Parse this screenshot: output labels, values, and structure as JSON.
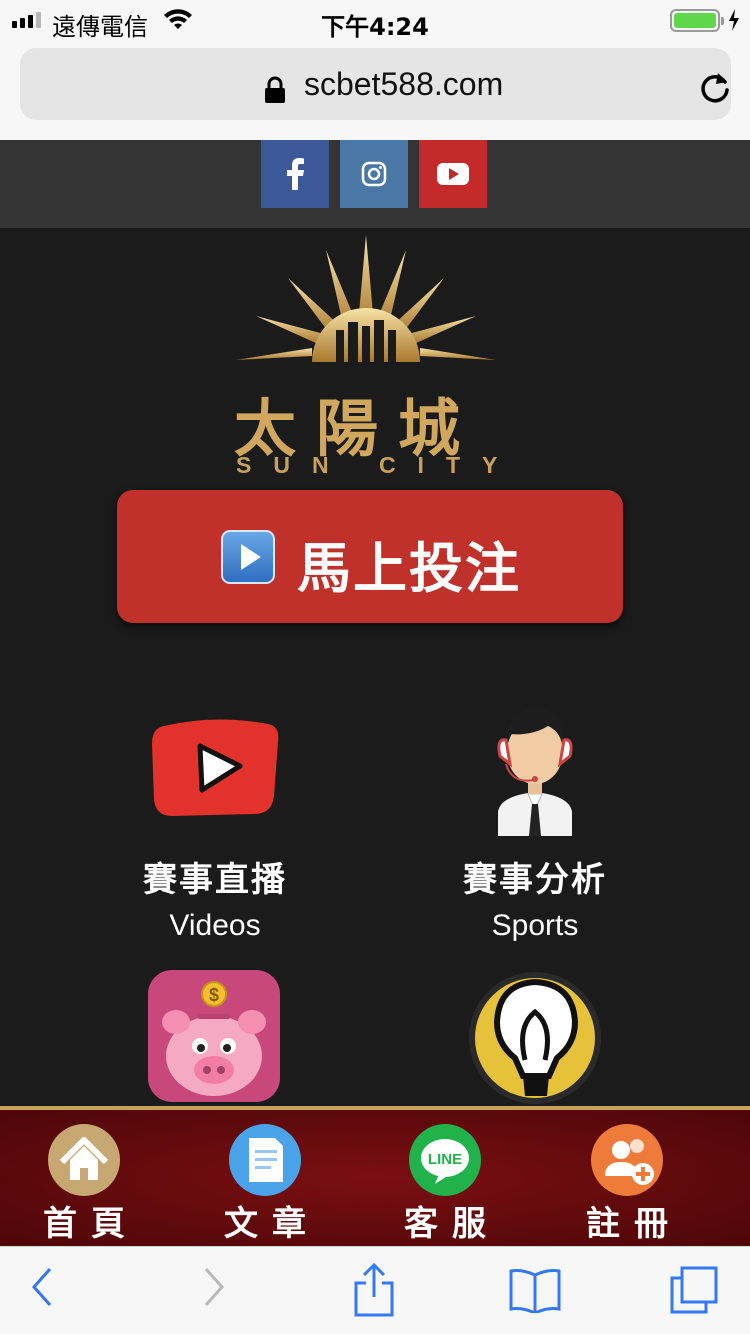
{
  "status_bar": {
    "carrier": "遠傳電信",
    "time": "下午4:24",
    "battery_level": 1.0
  },
  "browser": {
    "url": "scbet588.com"
  },
  "social": {
    "items": [
      "facebook-icon",
      "instagram-icon",
      "youtube-icon"
    ],
    "colors": {
      "facebook": "#3b5998",
      "instagram": "#4a77a6",
      "youtube": "#c52a2a"
    }
  },
  "logo": {
    "cn": "太陽城",
    "en": "SUN CITY"
  },
  "bet_button": {
    "label": "馬上投注"
  },
  "tiles": [
    {
      "cn": "賽事直播",
      "en": "Videos"
    },
    {
      "cn": "賽事分析",
      "en": "Sports"
    }
  ],
  "tab_bar": {
    "items": [
      {
        "label": "首頁",
        "icon": "home-icon"
      },
      {
        "label": "文章",
        "icon": "document-icon"
      },
      {
        "label": "客服",
        "icon": "line-icon",
        "icon_text": "LINE"
      },
      {
        "label": "註冊",
        "icon": "add-user-icon"
      }
    ]
  },
  "colors": {
    "background": "#1b1b1b",
    "accent_red": "#c0312c",
    "gold": "#d0a75c",
    "tab_bar": "#6a0b0e"
  }
}
